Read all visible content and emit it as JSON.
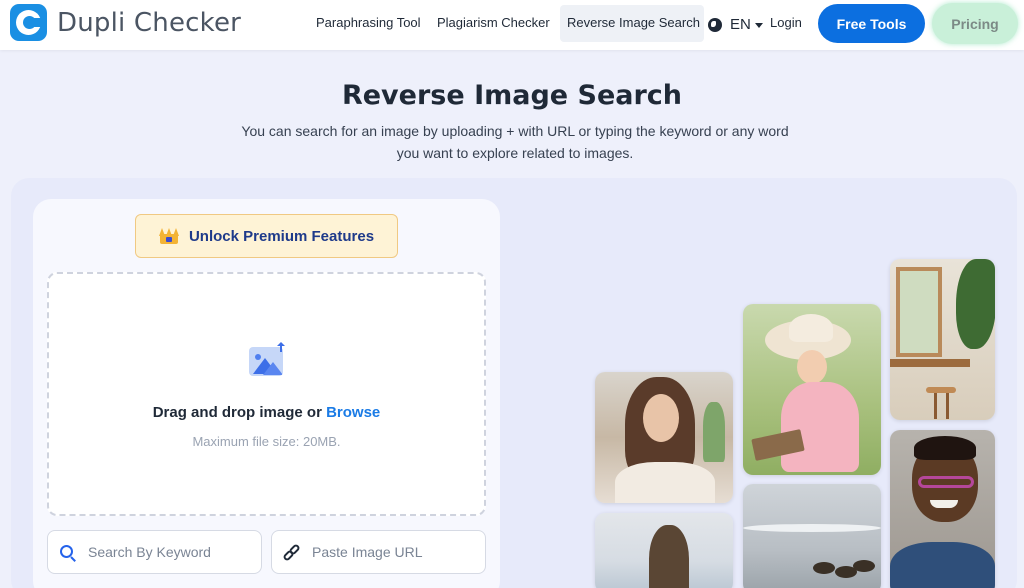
{
  "brand": {
    "name": "Dupli Checker"
  },
  "nav": {
    "items": [
      "Paraphrasing Tool",
      "Plagiarism Checker",
      "Reverse Image Search"
    ],
    "active": "Reverse Image Search",
    "language": "EN",
    "login": "Login",
    "free_tools": "Free Tools",
    "pricing": "Pricing"
  },
  "hero": {
    "title": "Reverse Image Search",
    "subtitle_line1": "You can search for an image by uploading + with URL or typing the keyword or any word",
    "subtitle_line2": "you want to explore related to images."
  },
  "uploader": {
    "premium_label": "Unlock Premium Features",
    "drop_text": "Drag and drop image or ",
    "browse_label": "Browse",
    "max_size": "Maximum file size: 20MB."
  },
  "search": {
    "keyword_placeholder": "Search By Keyword",
    "url_placeholder": "Paste Image URL"
  },
  "colors": {
    "primary": "#0c6fe0",
    "pricing_bg": "#c9f0d9",
    "premium_bg": "#fef3d6",
    "link": "#1a7be6"
  },
  "icons": [
    "logo-icon",
    "globe-icon",
    "chevron-down-icon",
    "crown-icon",
    "image-upload-icon",
    "search-icon",
    "link-icon"
  ]
}
